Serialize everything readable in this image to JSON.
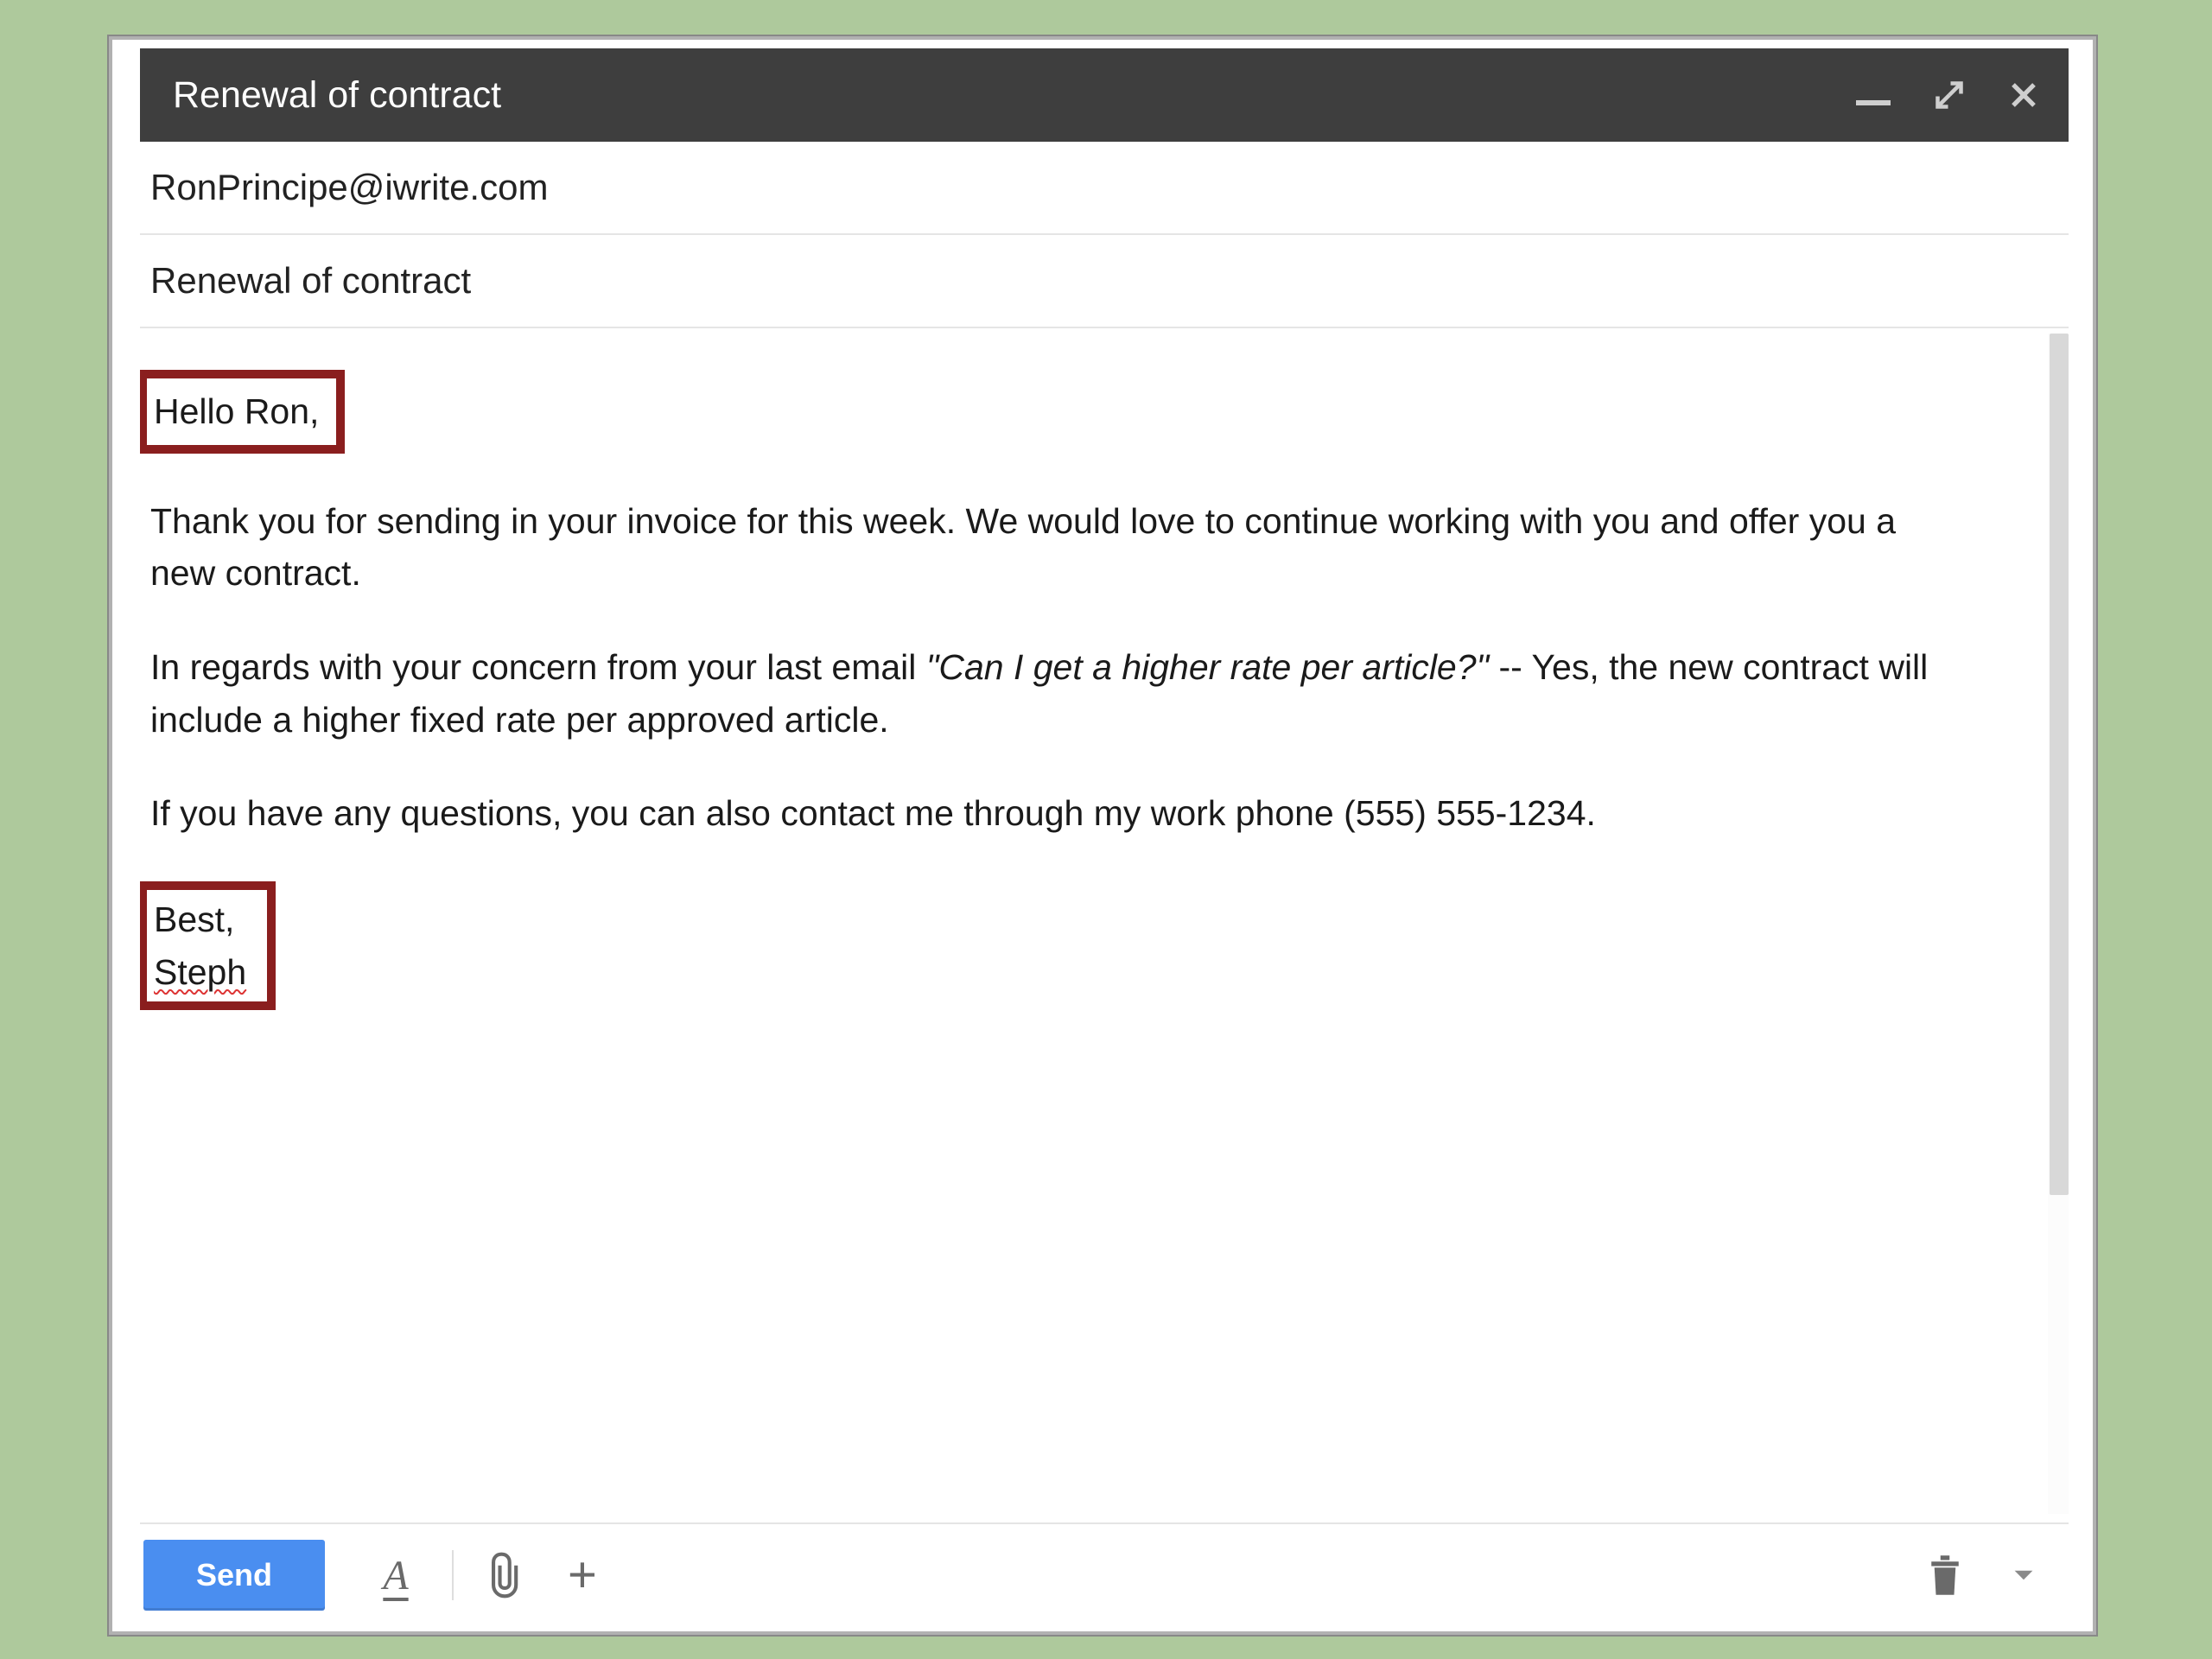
{
  "header": {
    "title": "Renewal of contract"
  },
  "recipient": "RonPrincipe@iwrite.com",
  "subject": "Renewal of contract",
  "body": {
    "greeting": "Hello Ron,",
    "p1": "Thank you for sending in your invoice for this week. We would love to continue working with you and offer you a new contract.",
    "p2_a": "In regards with your concern from your last email ",
    "p2_quote": "\"Can I get a higher rate per article?\"",
    "p2_b": " -- Yes, the new contract will include a higher fixed rate per approved article.",
    "p3": "If you have any questions, you can also contact me through my work phone (555) 555-1234.",
    "signoff": "Best,",
    "signature": "Steph"
  },
  "toolbar": {
    "send_label": "Send",
    "format_label": "A",
    "plus_label": "+"
  },
  "icons": {
    "minimize": "minimize-icon",
    "expand": "expand-icon",
    "close": "close-icon",
    "attach": "paperclip-icon",
    "trash": "trash-icon",
    "more": "caret-down-icon"
  }
}
